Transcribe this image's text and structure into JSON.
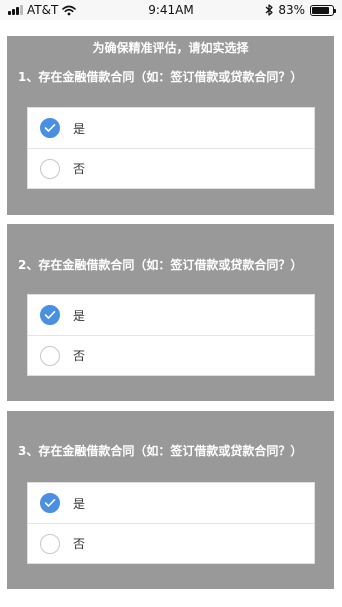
{
  "status_bar": {
    "carrier": "AT&T",
    "time": "9:41AM",
    "battery_percent": "83%",
    "battery_level": 0.83
  },
  "header": {
    "instruction": "为确保精准评估，请如实选择"
  },
  "questions": [
    {
      "text": "1、存在金融借款合同（如：签订借款或贷款合同？）",
      "options": [
        {
          "label": "是",
          "selected": true
        },
        {
          "label": "否",
          "selected": false
        }
      ]
    },
    {
      "text": "2、存在金融借款合同（如：签订借款或贷款合同？）",
      "options": [
        {
          "label": "是",
          "selected": true
        },
        {
          "label": "否",
          "selected": false
        }
      ]
    },
    {
      "text": "3、存在金融借款合同（如：签订借款或贷款合同？）",
      "options": [
        {
          "label": "是",
          "selected": true
        },
        {
          "label": "否",
          "selected": false
        }
      ]
    }
  ],
  "colors": {
    "card_background": "#999999",
    "accent_blue": "#4a90e2"
  }
}
